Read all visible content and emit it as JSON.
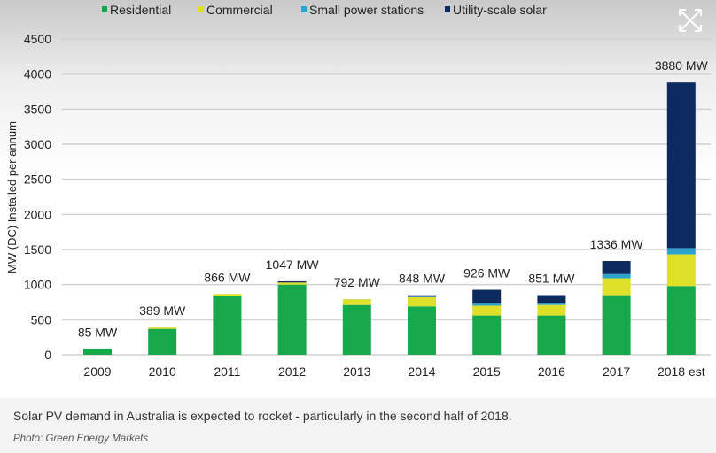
{
  "chart_data": {
    "type": "bar",
    "stacked": true,
    "ylabel": "MW (DC) Installed per annum",
    "ylim": [
      0,
      4500
    ],
    "yticks": [
      0,
      500,
      1000,
      1500,
      2000,
      2500,
      3000,
      3500,
      4000,
      4500
    ],
    "grid": true,
    "legend": "top",
    "categories": [
      "2009",
      "2010",
      "2011",
      "2012",
      "2013",
      "2014",
      "2015",
      "2016",
      "2017",
      "2018 est"
    ],
    "totals_labels": [
      "85 MW",
      "389 MW",
      "866 MW",
      "1047 MW",
      "792 MW",
      "848 MW",
      "926 MW",
      "851 MW",
      "1336 MW",
      "3880 MW"
    ],
    "series": [
      {
        "name": "Residential",
        "color": "#16a84a",
        "values": [
          85,
          370,
          840,
          1000,
          710,
          690,
          560,
          560,
          850,
          980
        ]
      },
      {
        "name": "Commercial",
        "color": "#dfe02a",
        "values": [
          0,
          19,
          26,
          30,
          80,
          130,
          140,
          150,
          240,
          450
        ]
      },
      {
        "name": "Small power stations",
        "color": "#2aa3d1",
        "values": [
          0,
          0,
          0,
          0,
          2,
          8,
          30,
          20,
          60,
          90
        ]
      },
      {
        "name": "Utility-scale solar",
        "color": "#0d2a5e",
        "values": [
          0,
          0,
          0,
          17,
          0,
          20,
          196,
          121,
          186,
          2360
        ]
      }
    ]
  },
  "caption": {
    "text": "Solar PV demand in Australia is expected to rocket - particularly in the second half of 2018.",
    "photo": "Photo: Green Energy Markets"
  }
}
